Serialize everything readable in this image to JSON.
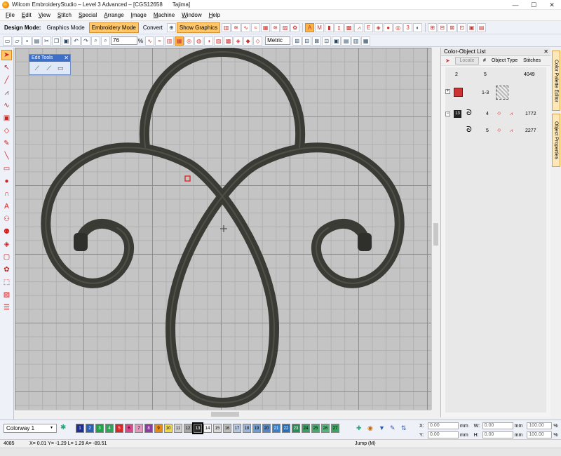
{
  "window": {
    "title": "Wilcom EmbroideryStudio – Level 3 Advanced – [CGS12658",
    "machine": "Tajima]",
    "minimize": "—",
    "maximize": "☐",
    "close": "✕"
  },
  "menu": [
    "File",
    "Edit",
    "View",
    "Stitch",
    "Special",
    "Arrange",
    "Image",
    "Machine",
    "Window",
    "Help"
  ],
  "toolbar": {
    "design_mode_label": "Design Mode:",
    "graphics_mode": "Graphics Mode",
    "embroidery_mode": "Embroidery Mode",
    "convert": "Convert",
    "show_graphics": "Show Graphics",
    "zoom_value": "76",
    "zoom_unit": "%",
    "units": "Metric"
  },
  "edit_tools": {
    "title": "Edit Tools",
    "close": "✕"
  },
  "color_object_list": {
    "title": "Color-Object List",
    "close": "✕",
    "locate": "Locate",
    "headers": {
      "number": "#",
      "type": "Object Type",
      "stitches": "Stitches"
    },
    "rows": [
      {
        "color": "2",
        "number": "5",
        "stitches": "4049"
      },
      {
        "color": "",
        "number": "1-3",
        "stitches": ""
      },
      {
        "color": "13",
        "number": "4",
        "stitches": "1772"
      },
      {
        "color": "",
        "number": "5",
        "stitches": "2277"
      }
    ]
  },
  "side_tabs": [
    "Color Palette Editor",
    "Object Properties"
  ],
  "colorway": {
    "selected": "Colorway 1",
    "swatches": [
      {
        "n": "1",
        "c": "#1f2f8f"
      },
      {
        "n": "2",
        "c": "#2c5fb4"
      },
      {
        "n": "3",
        "c": "#1ea34a"
      },
      {
        "n": "4",
        "c": "#2fa55a"
      },
      {
        "n": "5",
        "c": "#d6282a"
      },
      {
        "n": "6",
        "c": "#d94a8c"
      },
      {
        "n": "7",
        "c": "#e09ac0"
      },
      {
        "n": "8",
        "c": "#8a3f9e"
      },
      {
        "n": "9",
        "c": "#e68a1a"
      },
      {
        "n": "10",
        "c": "#f0d84a"
      },
      {
        "n": "11",
        "c": "#cfcfcf"
      },
      {
        "n": "12",
        "c": "#a8a8a8"
      },
      {
        "n": "13",
        "c": "#2a2a2a"
      },
      {
        "n": "14",
        "c": "#f4f4f4"
      },
      {
        "n": "15",
        "c": "#d8d8d8"
      },
      {
        "n": "16",
        "c": "#bdbdbd"
      },
      {
        "n": "17",
        "c": "#b8c7e0"
      },
      {
        "n": "18",
        "c": "#9ab5d9"
      },
      {
        "n": "19",
        "c": "#6f9fd1"
      },
      {
        "n": "20",
        "c": "#5887c4"
      },
      {
        "n": "21",
        "c": "#3a7fc4"
      },
      {
        "n": "22",
        "c": "#2b70b2"
      },
      {
        "n": "23",
        "c": "#2e8b57"
      },
      {
        "n": "24",
        "c": "#3d9a62"
      },
      {
        "n": "25",
        "c": "#49a96c"
      },
      {
        "n": "26",
        "c": "#54b47a"
      },
      {
        "n": "27",
        "c": "#3fa060"
      }
    ]
  },
  "coords": {
    "x_label": "X:",
    "x_value": "0.00",
    "x_unit": "mm",
    "y_label": "Y:",
    "y_value": "0.00",
    "y_unit": "mm",
    "w_label": "W:",
    "w_value": "0.00",
    "w_unit": "mm",
    "h_label": "H:",
    "h_value": "0.00",
    "h_unit": "mm",
    "sx_value": "100.00",
    "sy_value": "100.00",
    "pct": "%"
  },
  "status": {
    "stitch_count": "4085",
    "position": "X=   0.01 Y=  -1.29 L=   1.29 A=  -89.51",
    "mode": "Jump (M)"
  },
  "colors": {
    "embroidery": "#3b3b36",
    "canvas": "#c4c4c4",
    "accent": "#ffc76b"
  }
}
